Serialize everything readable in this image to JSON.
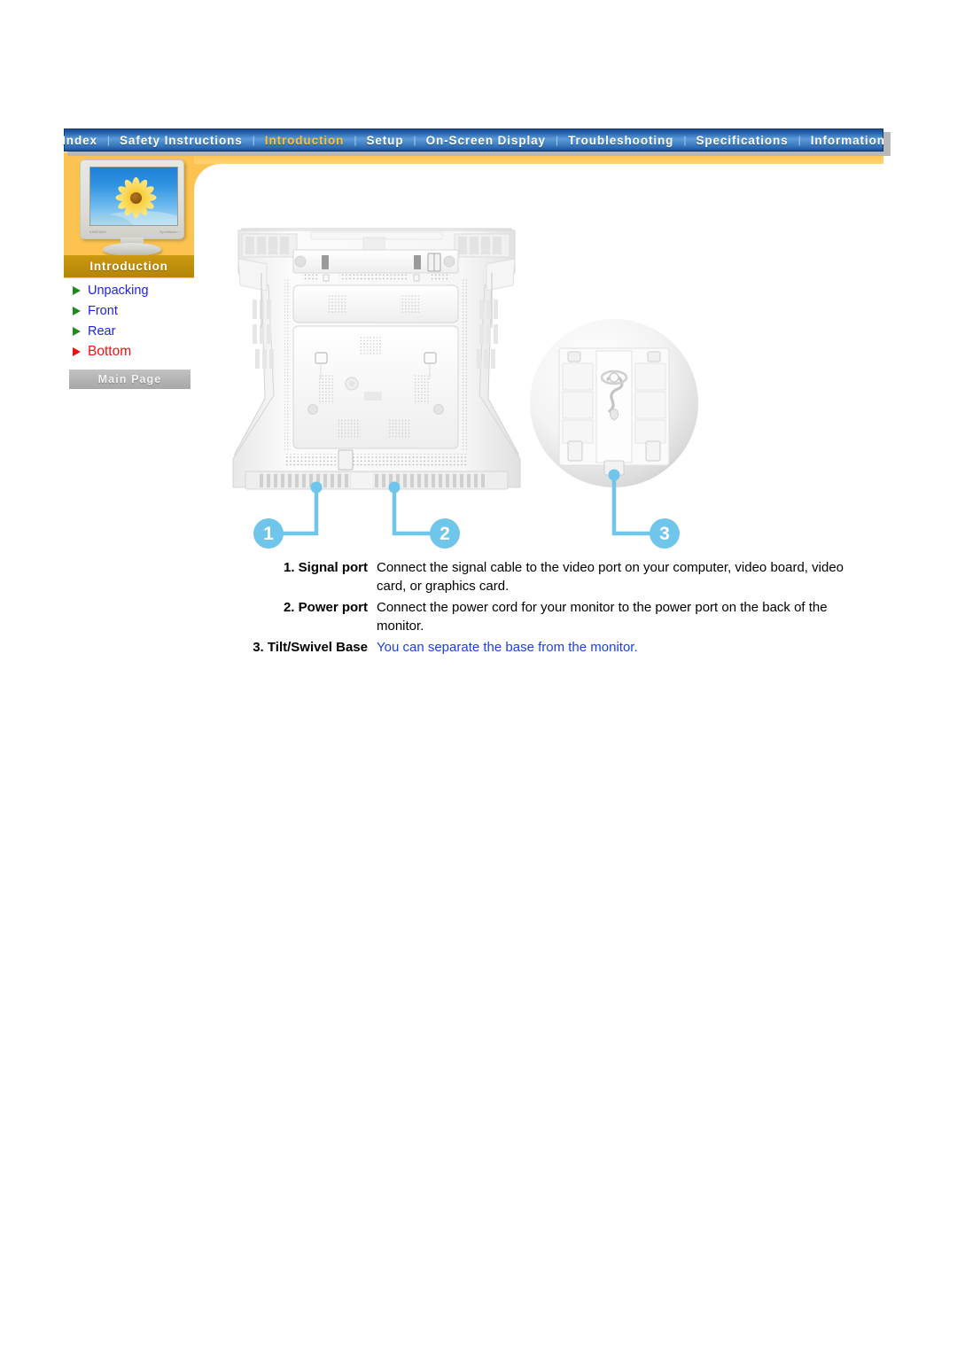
{
  "nav": {
    "separator": "|",
    "items": [
      {
        "label": "Index",
        "active": false
      },
      {
        "label": "Safety Instructions",
        "active": false
      },
      {
        "label": "Introduction",
        "active": true
      },
      {
        "label": "Setup",
        "active": false
      },
      {
        "label": "On-Screen Display",
        "active": false
      },
      {
        "label": "Troubleshooting",
        "active": false
      },
      {
        "label": "Specifications",
        "active": false
      },
      {
        "label": "Information",
        "active": false
      }
    ]
  },
  "sidebar": {
    "section_title": "Introduction",
    "thumbnail_alt": "monitor-with-sunflower-wallpaper",
    "items": [
      {
        "label": "Unpacking",
        "current": false
      },
      {
        "label": "Front",
        "current": false
      },
      {
        "label": "Rear",
        "current": false
      },
      {
        "label": "Bottom",
        "current": true
      }
    ],
    "main_page_button": "Main Page"
  },
  "diagram": {
    "alt": "monitor-bottom-view-with-tilt-swivel-base",
    "callouts": [
      {
        "number": "1"
      },
      {
        "number": "2"
      },
      {
        "number": "3"
      }
    ]
  },
  "descriptions": [
    {
      "label": "1. Signal port",
      "text": "Connect the signal cable to the video port on your computer, video board, video card, or graphics card.",
      "highlight": false
    },
    {
      "label": "2. Power port",
      "text": "Connect the power cord for your monitor to the power port on the back of the monitor.",
      "highlight": false
    },
    {
      "label": "3. Tilt/Swivel Base",
      "text": "You can separate the base from the monitor.",
      "highlight": true
    }
  ],
  "colors": {
    "nav_active": "#ffc426",
    "nav_blue": "#2f6bb5",
    "orange_band": "#fcc351",
    "intro_bar": "#c08f0c",
    "link_blue": "#2020ee",
    "link_current_red": "#ee1111",
    "callout_blue": "#6fc5ea",
    "highlight_text": "#1c3fe0"
  }
}
